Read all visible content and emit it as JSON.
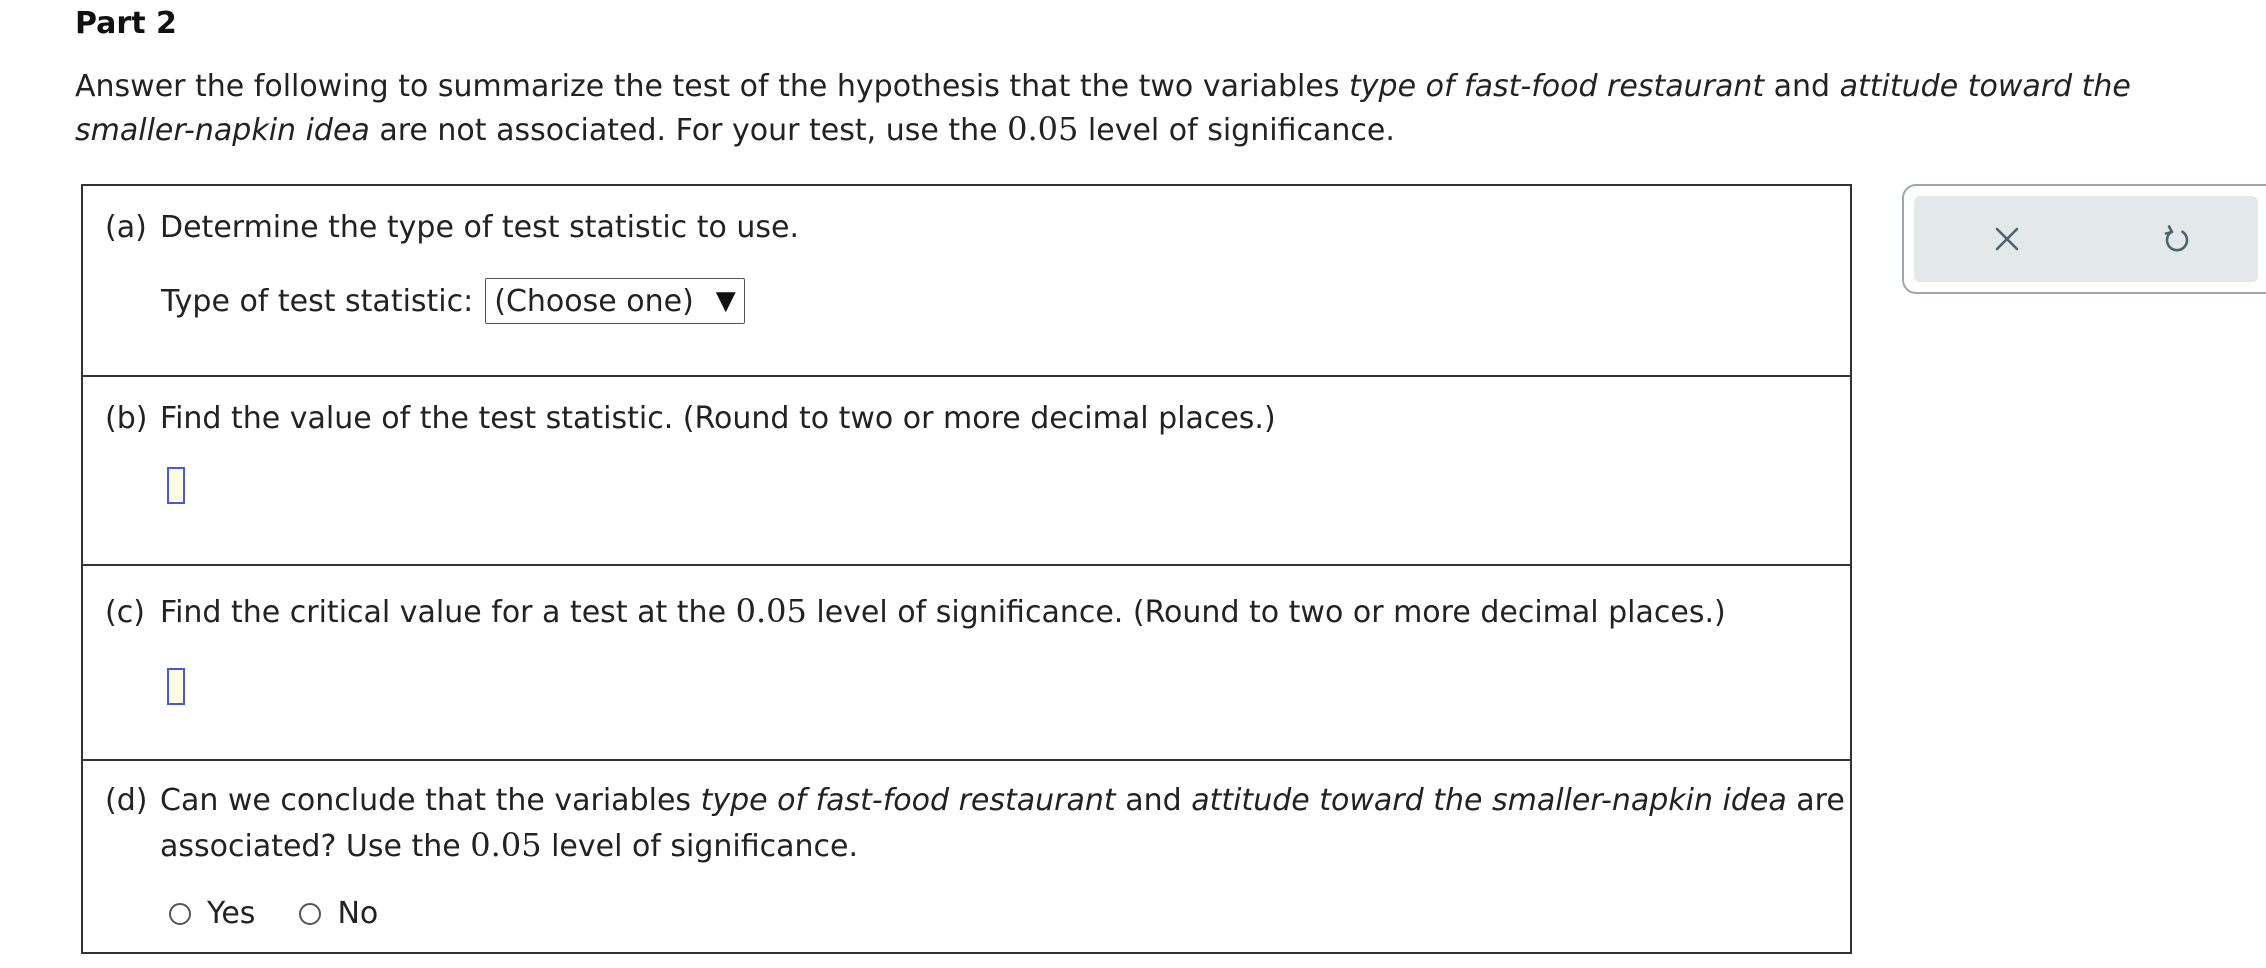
{
  "part_title": "Part 2",
  "intro": {
    "text_1": "Answer the following to summarize the test of the hypothesis that the two variables ",
    "var_1": "type of fast-food restaurant",
    "text_2": " and ",
    "var_2": "attitude toward the smaller-napkin idea",
    "text_3": " are not associated. For your test, use the ",
    "alpha": "0.05",
    "text_4": " level of significance."
  },
  "question_a": {
    "label": "(a)",
    "text": "Determine the type of test statistic to use.",
    "stat_label": "Type of test statistic:",
    "select_value": "(Choose one)",
    "select_arrow": "▼"
  },
  "question_b": {
    "label": "(b)",
    "text": "Find the value of the test statistic. (Round to two or more decimal places.)",
    "answer_value": ""
  },
  "question_c": {
    "label": "(c)",
    "text_1": "Find the critical value for a test at the ",
    "alpha": "0.05",
    "text_2": " level of significance. (Round to two or more decimal places.)",
    "answer_value": ""
  },
  "question_d": {
    "label": "(d)",
    "text_1": "Can we conclude that the variables ",
    "var_1": "type of fast-food restaurant",
    "text_2": " and ",
    "var_2": "attitude toward the smaller-napkin idea",
    "text_3": " are",
    "line2_1": "associated? Use the ",
    "alpha": "0.05",
    "line2_2": " level of significance.",
    "options": [
      "Yes",
      "No"
    ]
  },
  "tools": {
    "close_icon": "close-icon",
    "undo_icon": "undo-icon"
  },
  "colors": {
    "answer_border": "#4a55e0",
    "answer_fill": "#fffbe0",
    "tool_bg": "#e3e8ea",
    "tool_icon": "#4a6470"
  }
}
